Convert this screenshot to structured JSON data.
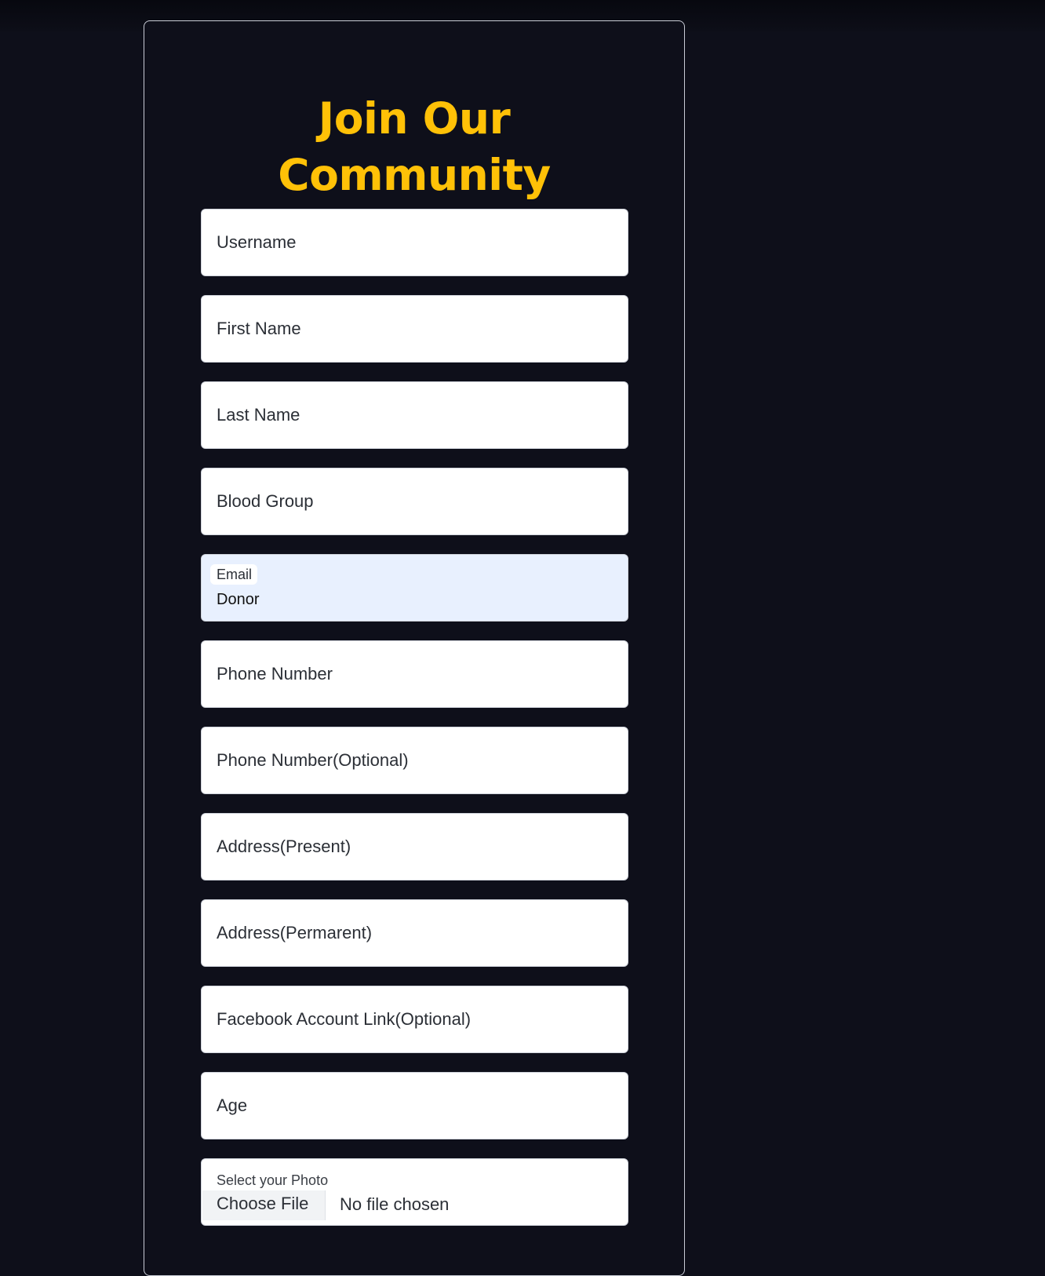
{
  "form": {
    "title_line1": "Join Our",
    "title_line2": "Community",
    "fields": [
      {
        "label": "Username"
      },
      {
        "label": "First Name"
      },
      {
        "label": "Last Name"
      },
      {
        "label": "Blood Group"
      },
      {
        "label": "Email",
        "value": "Donor"
      },
      {
        "label": "Phone Number"
      },
      {
        "label": "Phone Number(Optional)"
      },
      {
        "label": "Address(Present)"
      },
      {
        "label": "Address(Permarent)"
      },
      {
        "label": "Facebook Account Link(Optional)"
      },
      {
        "label": "Age"
      }
    ],
    "photo": {
      "label": "Select your Photo",
      "button": "Choose File",
      "status": "No file chosen"
    }
  },
  "colors": {
    "background": "#0e0f1a",
    "title": "#ffc107",
    "autofill": "#e8f0fe"
  }
}
